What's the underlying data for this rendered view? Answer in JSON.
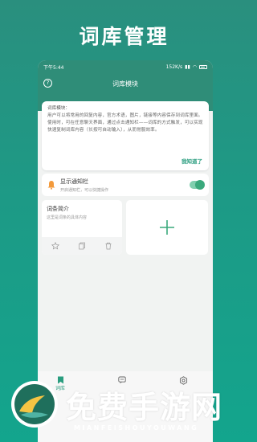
{
  "headline": "词库管理",
  "status": {
    "time": "下午5:44",
    "speed": "152K/s",
    "battery": "56"
  },
  "appbar": {
    "title": "词库模块"
  },
  "tip": {
    "title": "词库模块：",
    "body": "用户可以将常用的回复内容，官方术语，图片，链接等内容保存到词库里面。使用时，可在任意聊天界面，通过点击通知栏——词库的方式触发，可以实现快速复制词库内容（长按可自动输入），从而常服效率。",
    "ok": "我知道了"
  },
  "notify": {
    "title": "显示通知栏",
    "subtitle": "开启通知栏，可以快捷操作",
    "enabled": true
  },
  "entry": {
    "title": "词条简介",
    "subtitle": "这里是词条的具体内容"
  },
  "tabs": [
    {
      "label": "词库",
      "icon": "bookmark-icon"
    },
    {
      "label": "",
      "icon": "chat-icon"
    },
    {
      "label": "",
      "icon": "settings-icon"
    }
  ],
  "watermark": {
    "title": "免费手游网",
    "subtitle": "MIANFEISHOUYOUWANG"
  }
}
